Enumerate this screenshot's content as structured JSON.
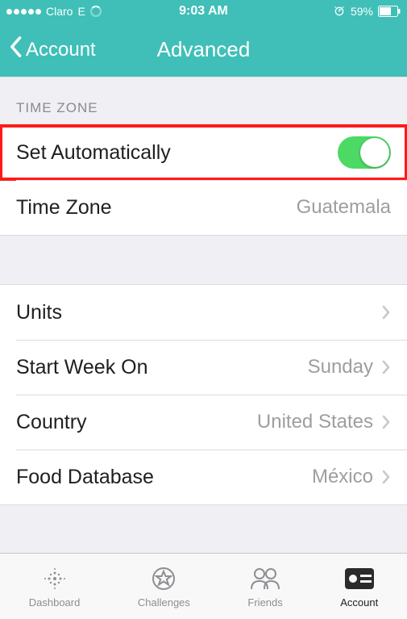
{
  "status": {
    "carrier": "Claro",
    "network": "E",
    "time": "9:03 AM",
    "battery_pct": "59%"
  },
  "nav": {
    "back_label": "Account",
    "title": "Advanced"
  },
  "sections": {
    "timezone_header": "TIME ZONE"
  },
  "timezone": {
    "set_auto_label": "Set Automatically",
    "set_auto_on": true,
    "tz_label": "Time Zone",
    "tz_value": "Guatemala"
  },
  "general": {
    "units_label": "Units",
    "start_week_label": "Start Week On",
    "start_week_value": "Sunday",
    "country_label": "Country",
    "country_value": "United States",
    "food_db_label": "Food Database",
    "food_db_value": "México"
  },
  "tabs": {
    "dashboard": "Dashboard",
    "challenges": "Challenges",
    "friends": "Friends",
    "account": "Account"
  },
  "colors": {
    "accent": "#3fbfb8",
    "toggle_on": "#4cd964",
    "highlight": "#ff1a1a"
  }
}
